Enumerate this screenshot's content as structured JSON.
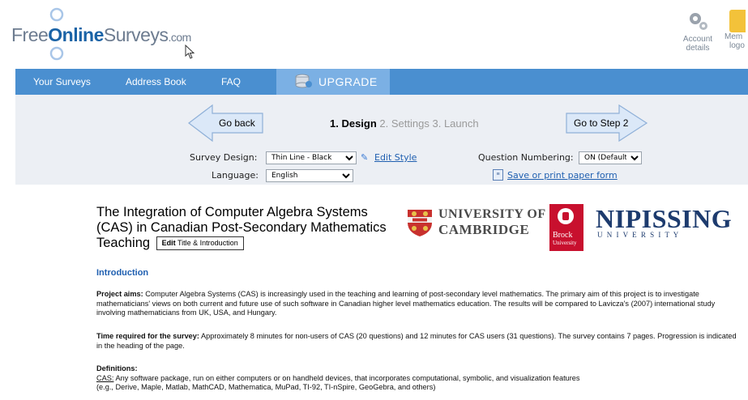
{
  "header": {
    "logo": {
      "part1": "Free",
      "part2": "Online",
      "part3": "Surveys",
      "suffix": ".com"
    },
    "account": {
      "label_line1": "Account",
      "label_line2": "details",
      "icon": "gears-icon"
    },
    "member": {
      "label_line1": "Mem",
      "label_line2": "logo",
      "icon": "member-icon"
    }
  },
  "nav": {
    "items": [
      "Your Surveys",
      "Address Book",
      "FAQ"
    ],
    "upgrade": "UPGRADE",
    "colors": {
      "bar": "#4a8fd0",
      "upgrade": "#7bb0e4"
    }
  },
  "steps": {
    "back": "Go back",
    "step1": "1. Design",
    "step2": "2. Settings",
    "step3": "3. Launch",
    "next": "Go to Step 2"
  },
  "settings": {
    "design_label": "Survey Design:",
    "design_value": "Thin Line - Black",
    "edit_style": "Edit Style",
    "numbering_label": "Question Numbering:",
    "numbering_value": "ON (Default)",
    "language_label": "Language:",
    "language_value": "English",
    "save_print": "Save or print paper form"
  },
  "survey": {
    "title": "The Integration of Computer Algebra Systems (CAS) in Canadian Post-Secondary Mathematics Teaching",
    "edit_bold": "Edit",
    "edit_rest": "Title & Introduction",
    "logos": {
      "cambridge_line1": "UNIVERSITY OF",
      "cambridge_line2": "CAMBRIDGE",
      "brock_line1": "Brock",
      "brock_line2": "University",
      "nipissing_line1": "NIPISSING",
      "nipissing_line2": "U N I V E R S I T Y"
    },
    "intro_heading": "Introduction",
    "aims_bold": "Project aims:",
    "aims_text": " Computer Algebra Systems (CAS) is increasingly used in the teaching and learning of post-secondary level mathematics. The primary aim of this project is to investigate mathematicians' views on both current and future use of such software in Canadian higher level mathematics education. The results will be compared to Lavicza's (2007) international study  involving mathematicians from UK, USA, and Hungary.",
    "time_bold": "Time required for the survey:",
    "time_text": " Approximately 8 minutes for non-users of CAS (20 questions) and 12 minutes for CAS users (31 questions). The survey contains 7 pages. Progression is indicated in the heading of the page.",
    "defs_heading": "Definitions:",
    "cas_term": "CAS:",
    "cas_text": " Any software package, run on either computers or on handheld devices, that incorporates computational, symbolic, and visualization features",
    "cas_examples": "(e.g., Derive, Maple, Matlab, MathCAD, Mathematica, MuPad, TI-92, TI-nSpire, GeoGebra, and others)"
  }
}
